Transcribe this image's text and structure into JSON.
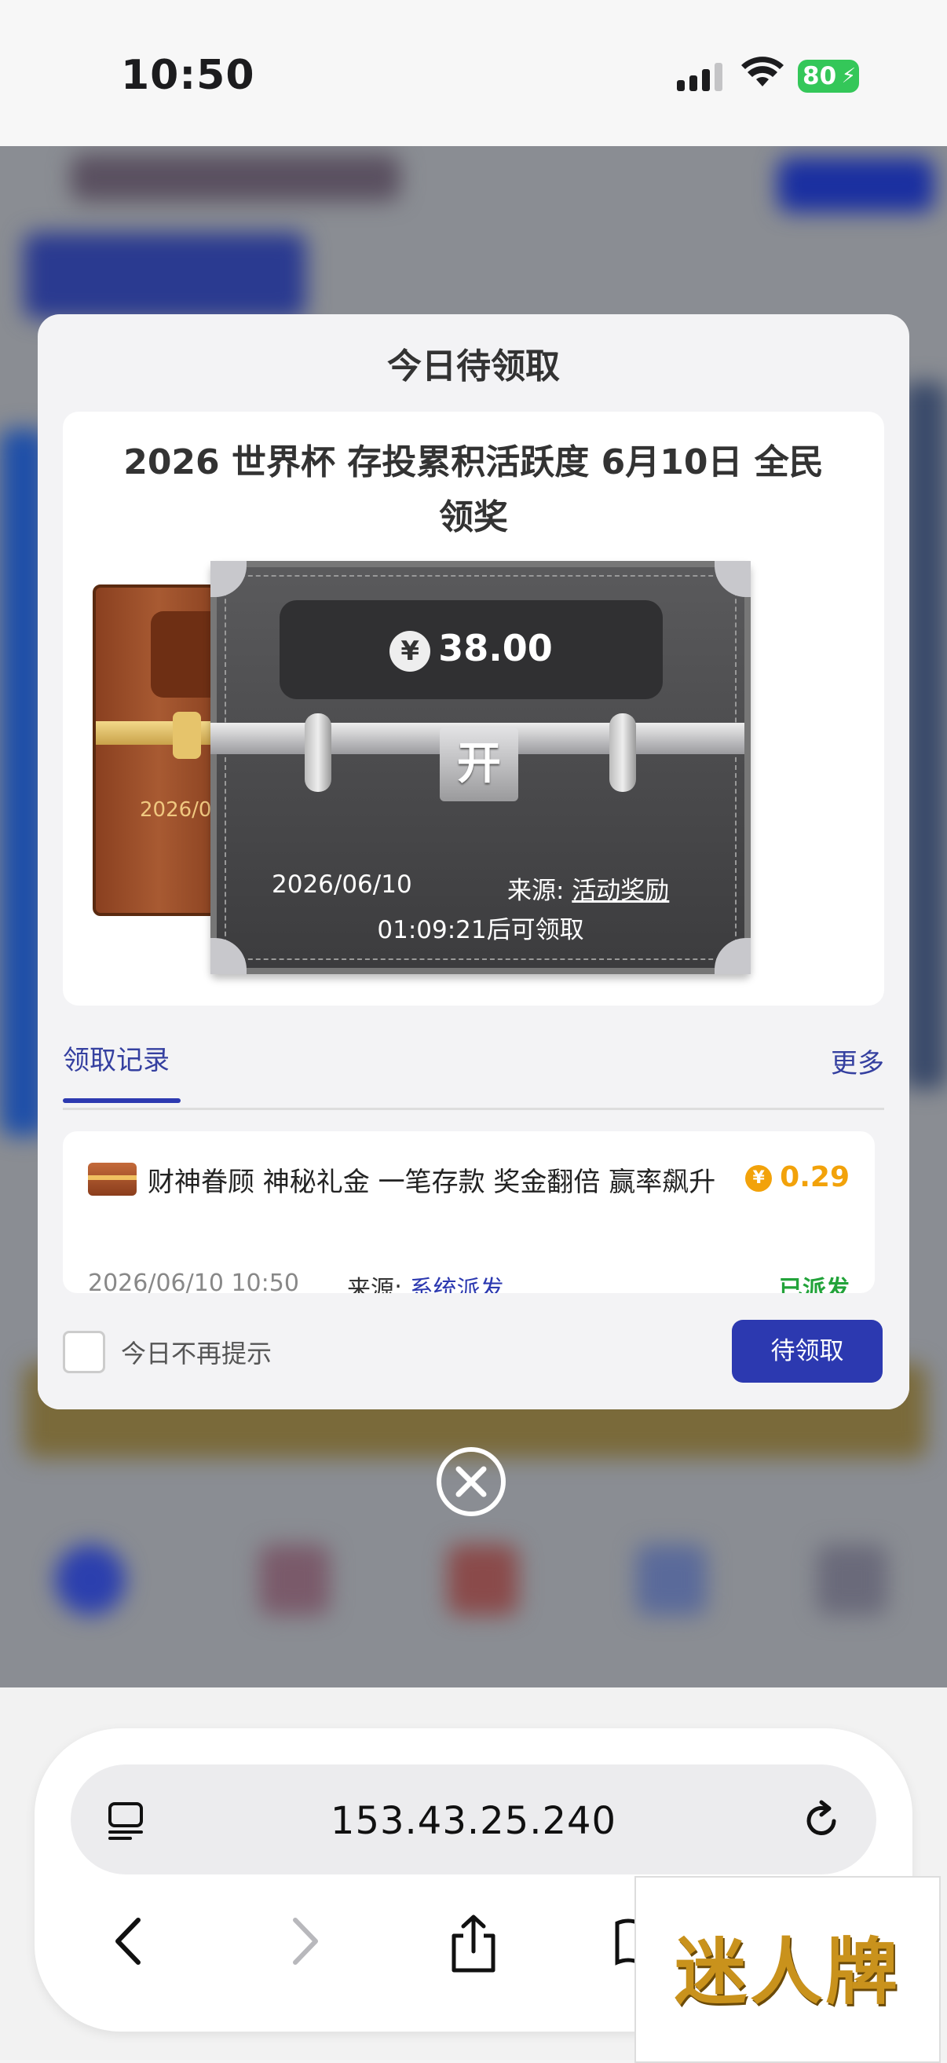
{
  "status_bar": {
    "time": "10:50",
    "battery": "80"
  },
  "dialog": {
    "title": "今日待领取",
    "card_title": "2026 世界杯 存投累积活跃度 6月10日 全民领奖",
    "chest": {
      "amount": "38.00",
      "currency_symbol": "¥",
      "open_label": "开",
      "date": "2026/06/10",
      "source_label": "来源:",
      "source_value": "活动奖励",
      "countdown": "01:09:21后可领取",
      "back_chest_date": "2026/0"
    },
    "tabs": {
      "active": "领取记录",
      "more": "更多"
    },
    "records": [
      {
        "title": "财神眷顾 神秘礼金 一笔存款 奖金翻倍 赢率飙升",
        "amount": "0.29",
        "date": "2026/06/10 10:50",
        "source_label": "来源:",
        "source_value": "系统派发",
        "status": "已派发"
      }
    ],
    "footer": {
      "dont_show_label": "今日不再提示",
      "pending_button": "待领取"
    }
  },
  "browser": {
    "url": "153.43.25.240"
  },
  "ad": {
    "text": "迷人牌"
  },
  "colors": {
    "primary": "#2c39b0",
    "gold": "#f2a20a",
    "success": "#22a33a",
    "battery": "#34c759"
  }
}
